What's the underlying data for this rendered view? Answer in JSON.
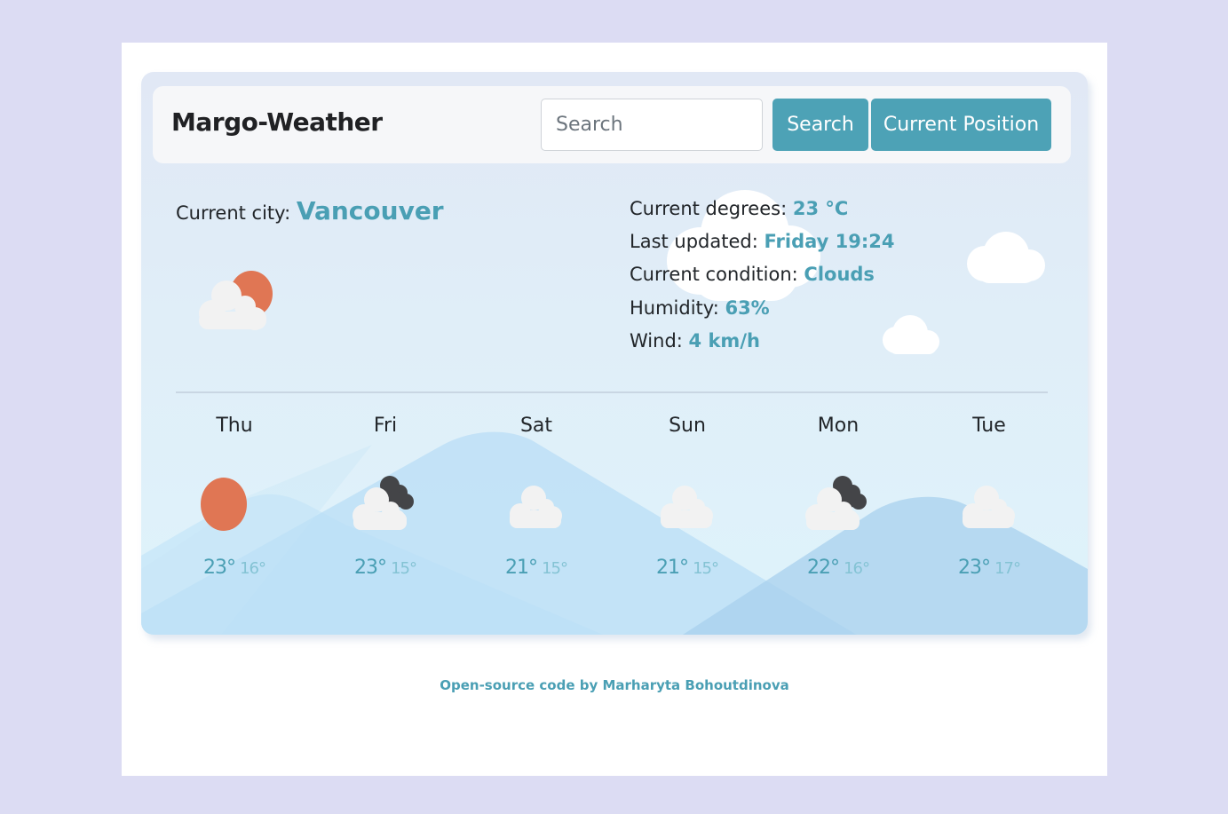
{
  "header": {
    "brand": "Margo-Weather",
    "search_placeholder": "Search",
    "search_value": "",
    "search_button": "Search",
    "position_button": "Current Position"
  },
  "current": {
    "city_label": "Current city:",
    "city": "Vancouver",
    "icon": "cloud-sun-icon",
    "details": [
      {
        "label": "Current degrees:",
        "value": "23 °C"
      },
      {
        "label": "Last updated:",
        "value": "Friday 19:24"
      },
      {
        "label": "Current condition:",
        "value": "Clouds"
      },
      {
        "label": "Humidity:",
        "value": "63%"
      },
      {
        "label": "Wind:",
        "value": "4 km/h"
      }
    ]
  },
  "forecast": [
    {
      "day": "Thu",
      "icon": "sun-icon",
      "max": "23°",
      "min": "16°"
    },
    {
      "day": "Fri",
      "icon": "cloud-dark-cloud-icon",
      "max": "23°",
      "min": "15°"
    },
    {
      "day": "Sat",
      "icon": "cloud-icon",
      "max": "21°",
      "min": "15°"
    },
    {
      "day": "Sun",
      "icon": "cloud-icon",
      "max": "21°",
      "min": "15°"
    },
    {
      "day": "Mon",
      "icon": "cloud-dark-cloud-icon",
      "max": "22°",
      "min": "16°"
    },
    {
      "day": "Tue",
      "icon": "cloud-icon",
      "max": "23°",
      "min": "17°"
    }
  ],
  "footer": {
    "text": "Open-source code by Marharyta Bohoutdinova"
  },
  "colors": {
    "accent": "#4a9fb4",
    "button": "#4da2b6",
    "sun": "#e07654",
    "dark_cloud": "#444548",
    "light_cloud": "#f2f2f2",
    "background": "#dcdcf3"
  }
}
